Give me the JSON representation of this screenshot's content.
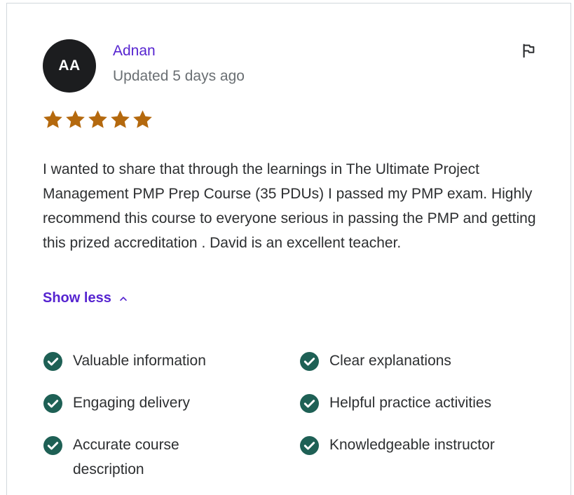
{
  "review": {
    "avatar_initials": "AA",
    "author": "Adnan",
    "updated": "Updated 5 days ago",
    "rating": 5,
    "rating_max": 5,
    "text": "I wanted to share that through the learnings in The Ultimate Project Management PMP Prep Course (35 PDUs) I passed my PMP exam. Highly recommend this course to everyone serious in passing the PMP and getting this prized accreditation . David is an excellent teacher.",
    "show_less_label": "Show less",
    "tags": [
      "Valuable information",
      "Clear explanations",
      "Engaging delivery",
      "Helpful practice activities",
      "Accurate course description",
      "Knowledgeable instructor"
    ]
  },
  "icons": {
    "flag": "flag-icon",
    "star": "star-icon",
    "chevron": "chevron-up-icon",
    "check": "check-circle-icon"
  },
  "colors": {
    "accent": "#5624d0",
    "star": "#b4690e",
    "check": "#1e6055",
    "avatar_bg": "#1c1d1f",
    "muted_text": "#6a6f73"
  }
}
